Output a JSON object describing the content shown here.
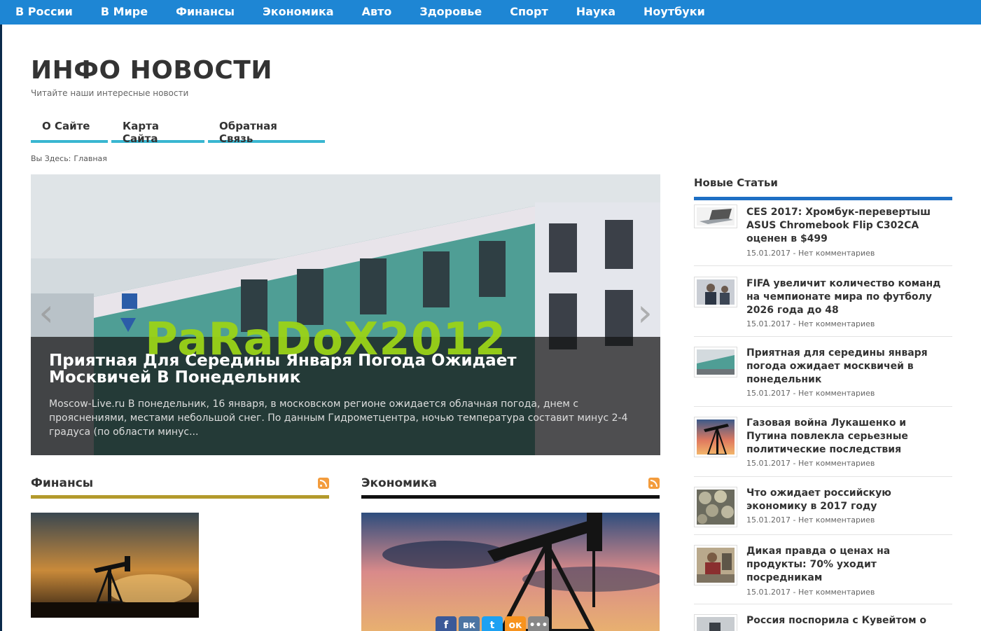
{
  "nav": {
    "items": [
      "В России",
      "В Мире",
      "Финансы",
      "Экономика",
      "Авто",
      "Здоровье",
      "Спорт",
      "Наука",
      "Ноутбуки"
    ]
  },
  "site": {
    "title": "ИНФО НОВОСТИ",
    "description": "Читайте наши интересные новости"
  },
  "page_nav": [
    "О Сайте",
    "Карта Сайта",
    "Обратная Связь"
  ],
  "breadcrumb": {
    "label": "Вы Здесь:",
    "current": "Главная"
  },
  "slider": {
    "title": "Приятная Для Середины Января Погода Ожидает Москвичей В Понедельник",
    "excerpt": "Moscow-Live.ru В понедельник, 16 января, в московском регионе ожидается облачная погода, днем с прояснениями, местами небольшой снег. По данным Гидрометцентра, ночью температура составит минус 2-4 градуса (по области минус...",
    "prev_arrow": "‹",
    "next_arrow": "›"
  },
  "watermark": "PaRaDoX2012",
  "categories": [
    {
      "title": "Финансы",
      "accent": "#b39a2c"
    },
    {
      "title": "Экономика",
      "accent": "#111111"
    }
  ],
  "share": [
    {
      "icon": "facebook-icon",
      "glyph": "f",
      "color": "#3b5998"
    },
    {
      "icon": "vk-icon",
      "glyph": "вк",
      "color": "#4c75a3"
    },
    {
      "icon": "twitter-icon",
      "glyph": "t",
      "color": "#1da1f2"
    },
    {
      "icon": "odnoklassniki-icon",
      "glyph": "ок",
      "color": "#f7931e"
    },
    {
      "icon": "more-icon",
      "glyph": "•••",
      "color": "#888888"
    }
  ],
  "sidebar": {
    "title": "Новые Статьи",
    "posts": [
      {
        "title": "CES 2017: Хромбук-перевертыш ASUS Chromebook Flip C302CA оценен в $499",
        "meta": "15.01.2017 - Нет комментариев"
      },
      {
        "title": "FIFA увеличит количество команд на чемпионате мира по футболу 2026 года до 48",
        "meta": "15.01.2017 - Нет комментариев"
      },
      {
        "title": "Приятная для середины января погода ожидает москвичей в понедельник",
        "meta": "15.01.2017 - Нет комментариев"
      },
      {
        "title": "Газовая война Лукашенко и Путина повлекла серьезные политические последствия",
        "meta": "15.01.2017 - Нет комментариев"
      },
      {
        "title": "Что ожидает российскую экономику в 2017 году",
        "meta": "15.01.2017 - Нет комментариев"
      },
      {
        "title": "Дикая правда о ценах на продукты: 70% уходит посредникам",
        "meta": "15.01.2017 - Нет комментариев"
      },
      {
        "title": "Россия поспорила с Кувейтом о",
        "meta": ""
      }
    ]
  },
  "colors": {
    "nav_bg": "#1e86d4",
    "page_nav_accent": "#39b6d1",
    "sidebar_accent": "#1e6fc4",
    "watermark": "#9ad318"
  }
}
